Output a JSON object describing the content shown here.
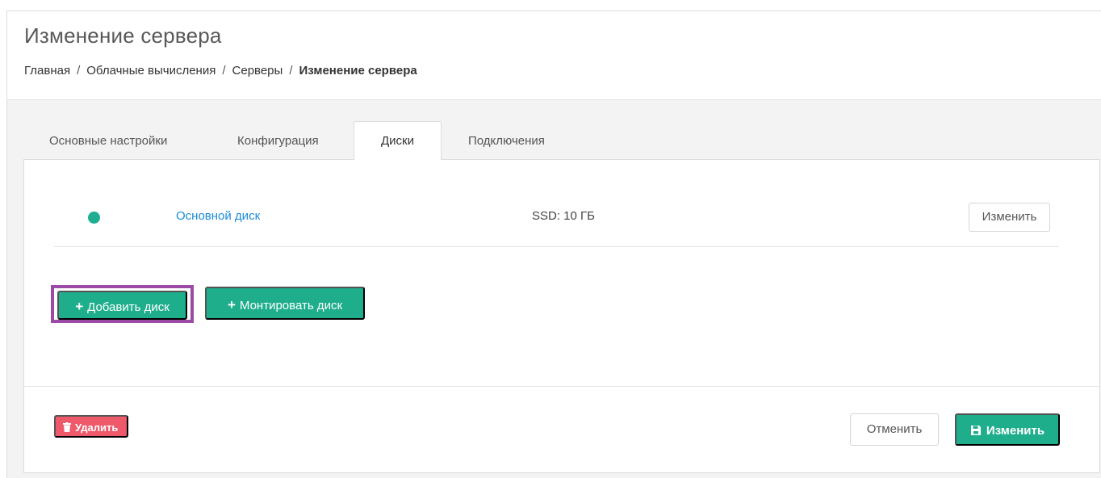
{
  "header": {
    "title": "Изменение сервера",
    "breadcrumb": [
      "Главная",
      "Облачные вычисления",
      "Серверы",
      "Изменение сервера"
    ],
    "separator": "/"
  },
  "tabs": [
    {
      "label": "Основные настройки",
      "active": false
    },
    {
      "label": "Конфигурация",
      "active": false
    },
    {
      "label": "Диски",
      "active": true
    },
    {
      "label": "Подключения",
      "active": false
    }
  ],
  "disks": [
    {
      "name": "Основной диск",
      "size": "SSD: 10 ГБ",
      "status": "active",
      "status_color": "#1fae92",
      "edit_label": "Изменить"
    }
  ],
  "actions": {
    "add_disk_label": "Добавить диск",
    "mount_disk_label": "Монтировать диск",
    "plus_symbol": "+",
    "highlight_color": "#9b4aa6"
  },
  "footer": {
    "delete_label": "Удалить",
    "cancel_label": "Отменить",
    "save_label": "Изменить"
  },
  "colors": {
    "accent_green": "#1fae8c",
    "danger_red": "#ee5a6a",
    "link_blue": "#1a8bd6"
  }
}
